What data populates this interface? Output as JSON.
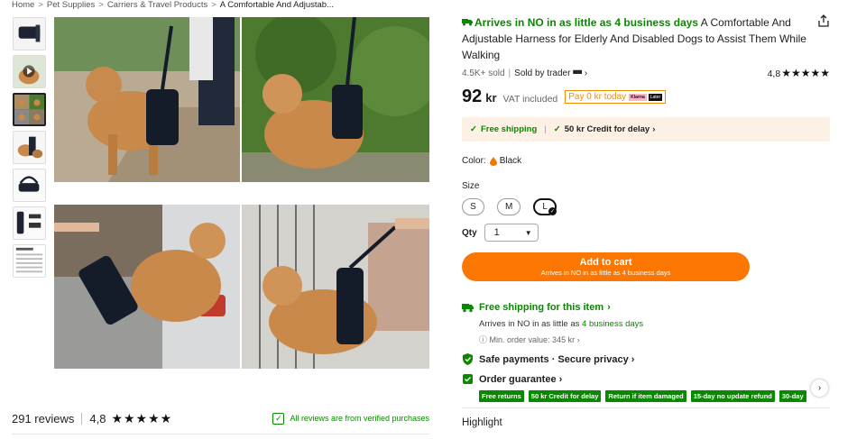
{
  "breadcrumb": {
    "items": [
      "Home",
      "Pet Supplies",
      "Carriers & Travel Products"
    ],
    "current": "A Comfortable And Adjustab...",
    "separator": ">"
  },
  "gallery": {
    "thumbnail_count": 7,
    "active_thumbnail": 3,
    "colors": {
      "dog": "#c8894a",
      "harness": "#1a2233",
      "grass": "#4d7a2f",
      "pavement": "#b7a890"
    }
  },
  "reviews": {
    "count_label": "291 reviews",
    "rating": "4,8",
    "stars": "★★★★★",
    "verified_label": "All reviews are from verified purchases"
  },
  "product": {
    "arrival_headline": "Arrives in NO in as little as 4 business days",
    "title": " A Comfortable And Adjustable Harness for Elderly And Disabled Dogs to Assist Them While Walking",
    "sold": "4.5K+ sold",
    "seller_label": "Sold by trader",
    "rating": "4,8",
    "stars": "★★★★★",
    "price": "92",
    "currency": "kr",
    "vat": "VAT included",
    "pay_later": "Pay 0 kr today",
    "pay_klarna": "Klarna",
    "pay_later_badge": "Later"
  },
  "shipping_box": {
    "free_shipping": "Free shipping",
    "credit": "50 kr Credit for delay"
  },
  "options": {
    "color_label": "Color:",
    "color_value": "Black",
    "size_label": "Size",
    "sizes": [
      "S",
      "M",
      "L"
    ],
    "selected_size": "L",
    "qty_label": "Qty",
    "qty_value": "1"
  },
  "cart": {
    "button_label": "Add to cart",
    "button_sub": "Arrives in NO in as little as 4 business days"
  },
  "service": {
    "free_shipping_title": "Free shipping for this item",
    "arrives_prefix": "Arrives in NO in as little as ",
    "arrives_days": "4 business days",
    "min_order": "Min. order value: 345 kr",
    "safe_payments": "Safe payments · Secure privacy",
    "order_guarantee": "Order guarantee",
    "badges": [
      "Free returns",
      "50 kr Credit for delay",
      "Return if item damaged",
      "15-day no update refund",
      "30-day"
    ]
  },
  "highlight_label": "Highlight",
  "accent_colors": {
    "orange": "#fb7701",
    "green": "#0a8800",
    "ship_bg": "#fdf0e4"
  }
}
